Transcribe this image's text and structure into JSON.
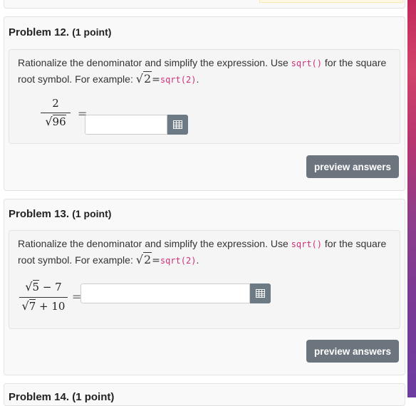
{
  "problems": [
    {
      "number_label": "Problem 12.",
      "points_label": "(1 point)",
      "instruction_before_code": "Rationalize the denominator and simplify the expression. Use ",
      "code_inline": "sqrt()",
      "instruction_after_code": " for the square root symbol. For example: ",
      "example_radicand": "2",
      "example_equals": "=",
      "example_code": "sqrt(2)",
      "example_period": ".",
      "fraction": {
        "numerator_text": "2",
        "denominator_radicand": "96",
        "denominator_suffix": ""
      },
      "equals_sign": "=",
      "answer_value": "",
      "preview_label": "preview answers"
    },
    {
      "number_label": "Problem 13.",
      "points_label": "(1 point)",
      "instruction_before_code": "Rationalize the denominator and simplify the expression. Use ",
      "code_inline": "sqrt()",
      "instruction_after_code": " for the square root symbol. For example: ",
      "example_radicand": "2",
      "example_equals": "=",
      "example_code": "sqrt(2)",
      "example_period": ".",
      "fraction": {
        "numerator_radicand": "5",
        "numerator_suffix": " − 7",
        "denominator_radicand": "7",
        "denominator_suffix": " + 10"
      },
      "equals_sign": "=",
      "answer_value": "",
      "preview_label": "preview answers"
    }
  ],
  "next_problem_title": "Problem 14. (1 point)",
  "icons": {
    "matrix": "grid-table-icon"
  },
  "colors": {
    "code": "#d0307a",
    "button": "#6c757d",
    "accent_strip": "#c22a5c"
  }
}
